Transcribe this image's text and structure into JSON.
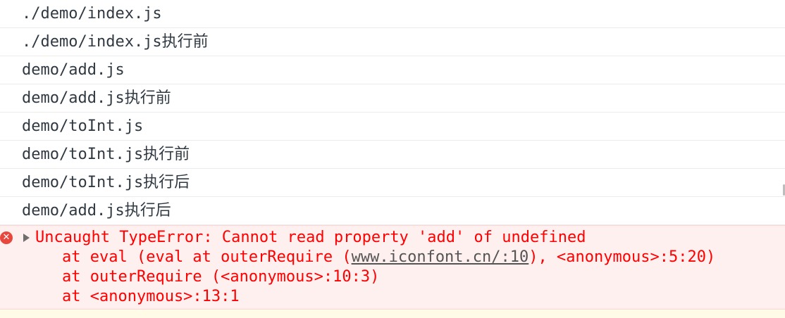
{
  "logs": [
    "./demo/index.js",
    "./demo/index.js执行前",
    "demo/add.js",
    "demo/add.js执行前",
    "demo/toInt.js",
    "demo/toInt.js执行前",
    "demo/toInt.js执行后",
    "demo/add.js执行后"
  ],
  "error": {
    "icon": "error-circle-icon",
    "message": "Uncaught TypeError: Cannot read property 'add' of undefined",
    "stack": [
      {
        "prefix": "at eval (eval at outerRequire (",
        "link": "www.iconfont.cn/:10",
        "suffix": "), <anonymous>:5:20)"
      },
      {
        "prefix": "at outerRequire (<anonymous>:10:3)",
        "link": "",
        "suffix": ""
      },
      {
        "prefix": "at <anonymous>:13:1",
        "link": "",
        "suffix": ""
      }
    ]
  },
  "colors": {
    "error_text": "#ff0000",
    "error_bg": "#fff0f0",
    "log_text": "#303942"
  }
}
